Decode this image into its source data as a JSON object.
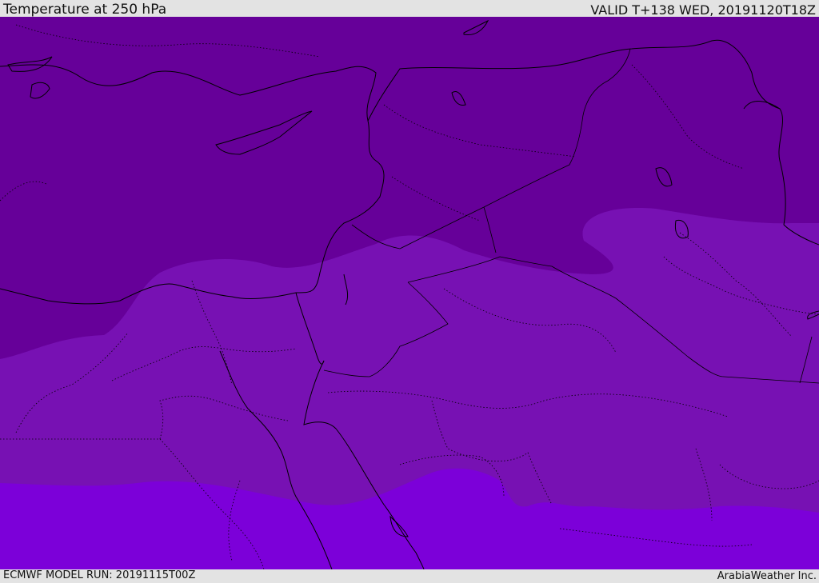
{
  "header": {
    "title": "Temperature at 250 hPa",
    "valid_time": "VALID T+138 WED, 20191120T18Z"
  },
  "footer": {
    "model_run": "ECMWF MODEL RUN: 20191115T00Z",
    "credit": "ArabiaWeather Inc."
  },
  "map": {
    "field": "temperature_250hPa",
    "shading_colors": {
      "cold_band": "#660099",
      "mid_band": "#7711b3",
      "warm_band": "#7c00d9"
    },
    "line_color": "#000000"
  }
}
